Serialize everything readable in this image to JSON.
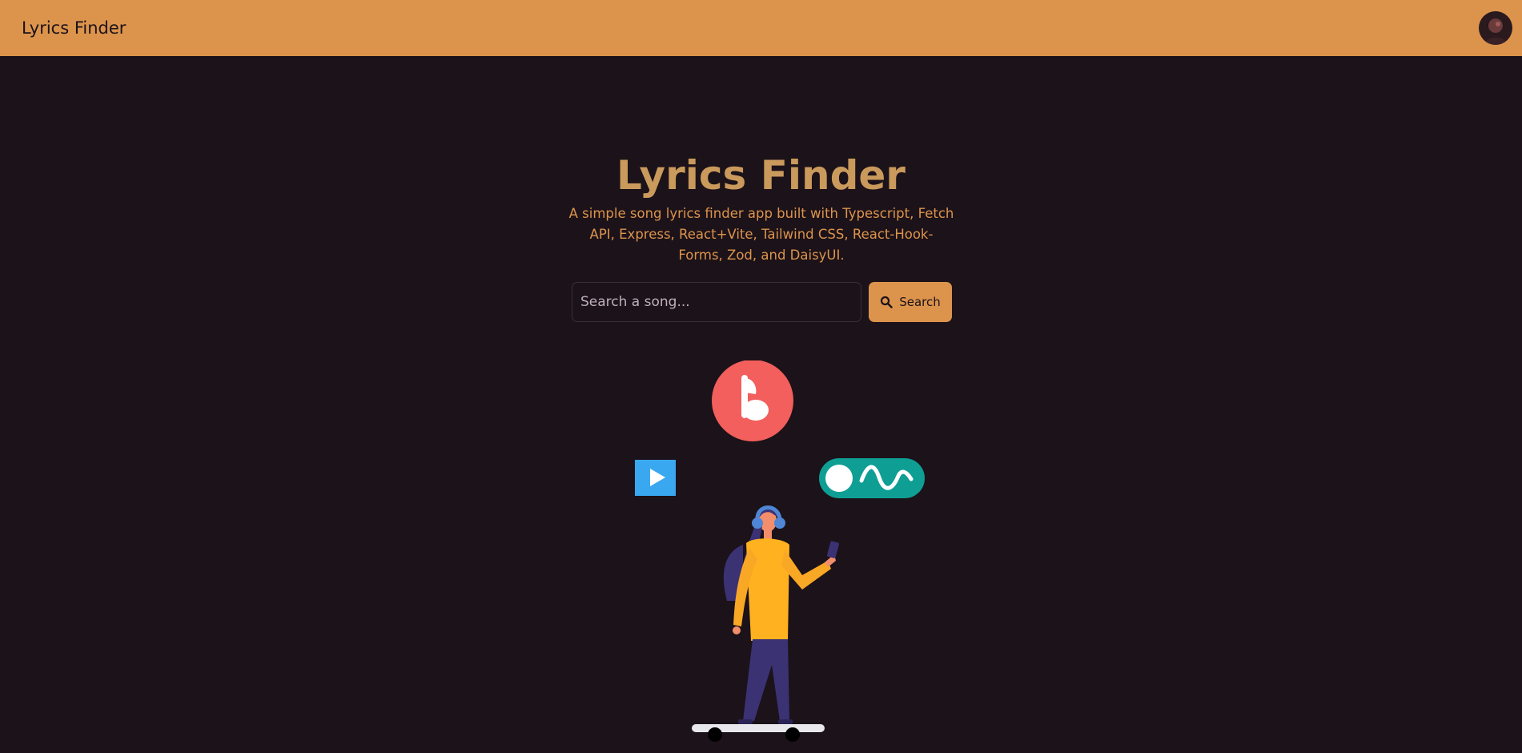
{
  "navbar": {
    "brand": "Lyrics Finder"
  },
  "hero": {
    "title": "Lyrics Finder",
    "description": "A simple song lyrics finder app built with Typescript, Fetch API, Express, React+Vite, Tailwind CSS, React-Hook-Forms, Zod, and DaisyUI."
  },
  "search": {
    "placeholder": "Search a song...",
    "button_label": "Search"
  },
  "icons": {
    "search": "search-icon",
    "avatar": "avatar",
    "music_note": "music-note-icon",
    "play": "play-icon",
    "toggle_wave": "toggle-wave-icon"
  },
  "colors": {
    "navbar": "#dc944c",
    "background": "#1c1219",
    "title": "#c99a5c",
    "accent": "#dc944c"
  }
}
